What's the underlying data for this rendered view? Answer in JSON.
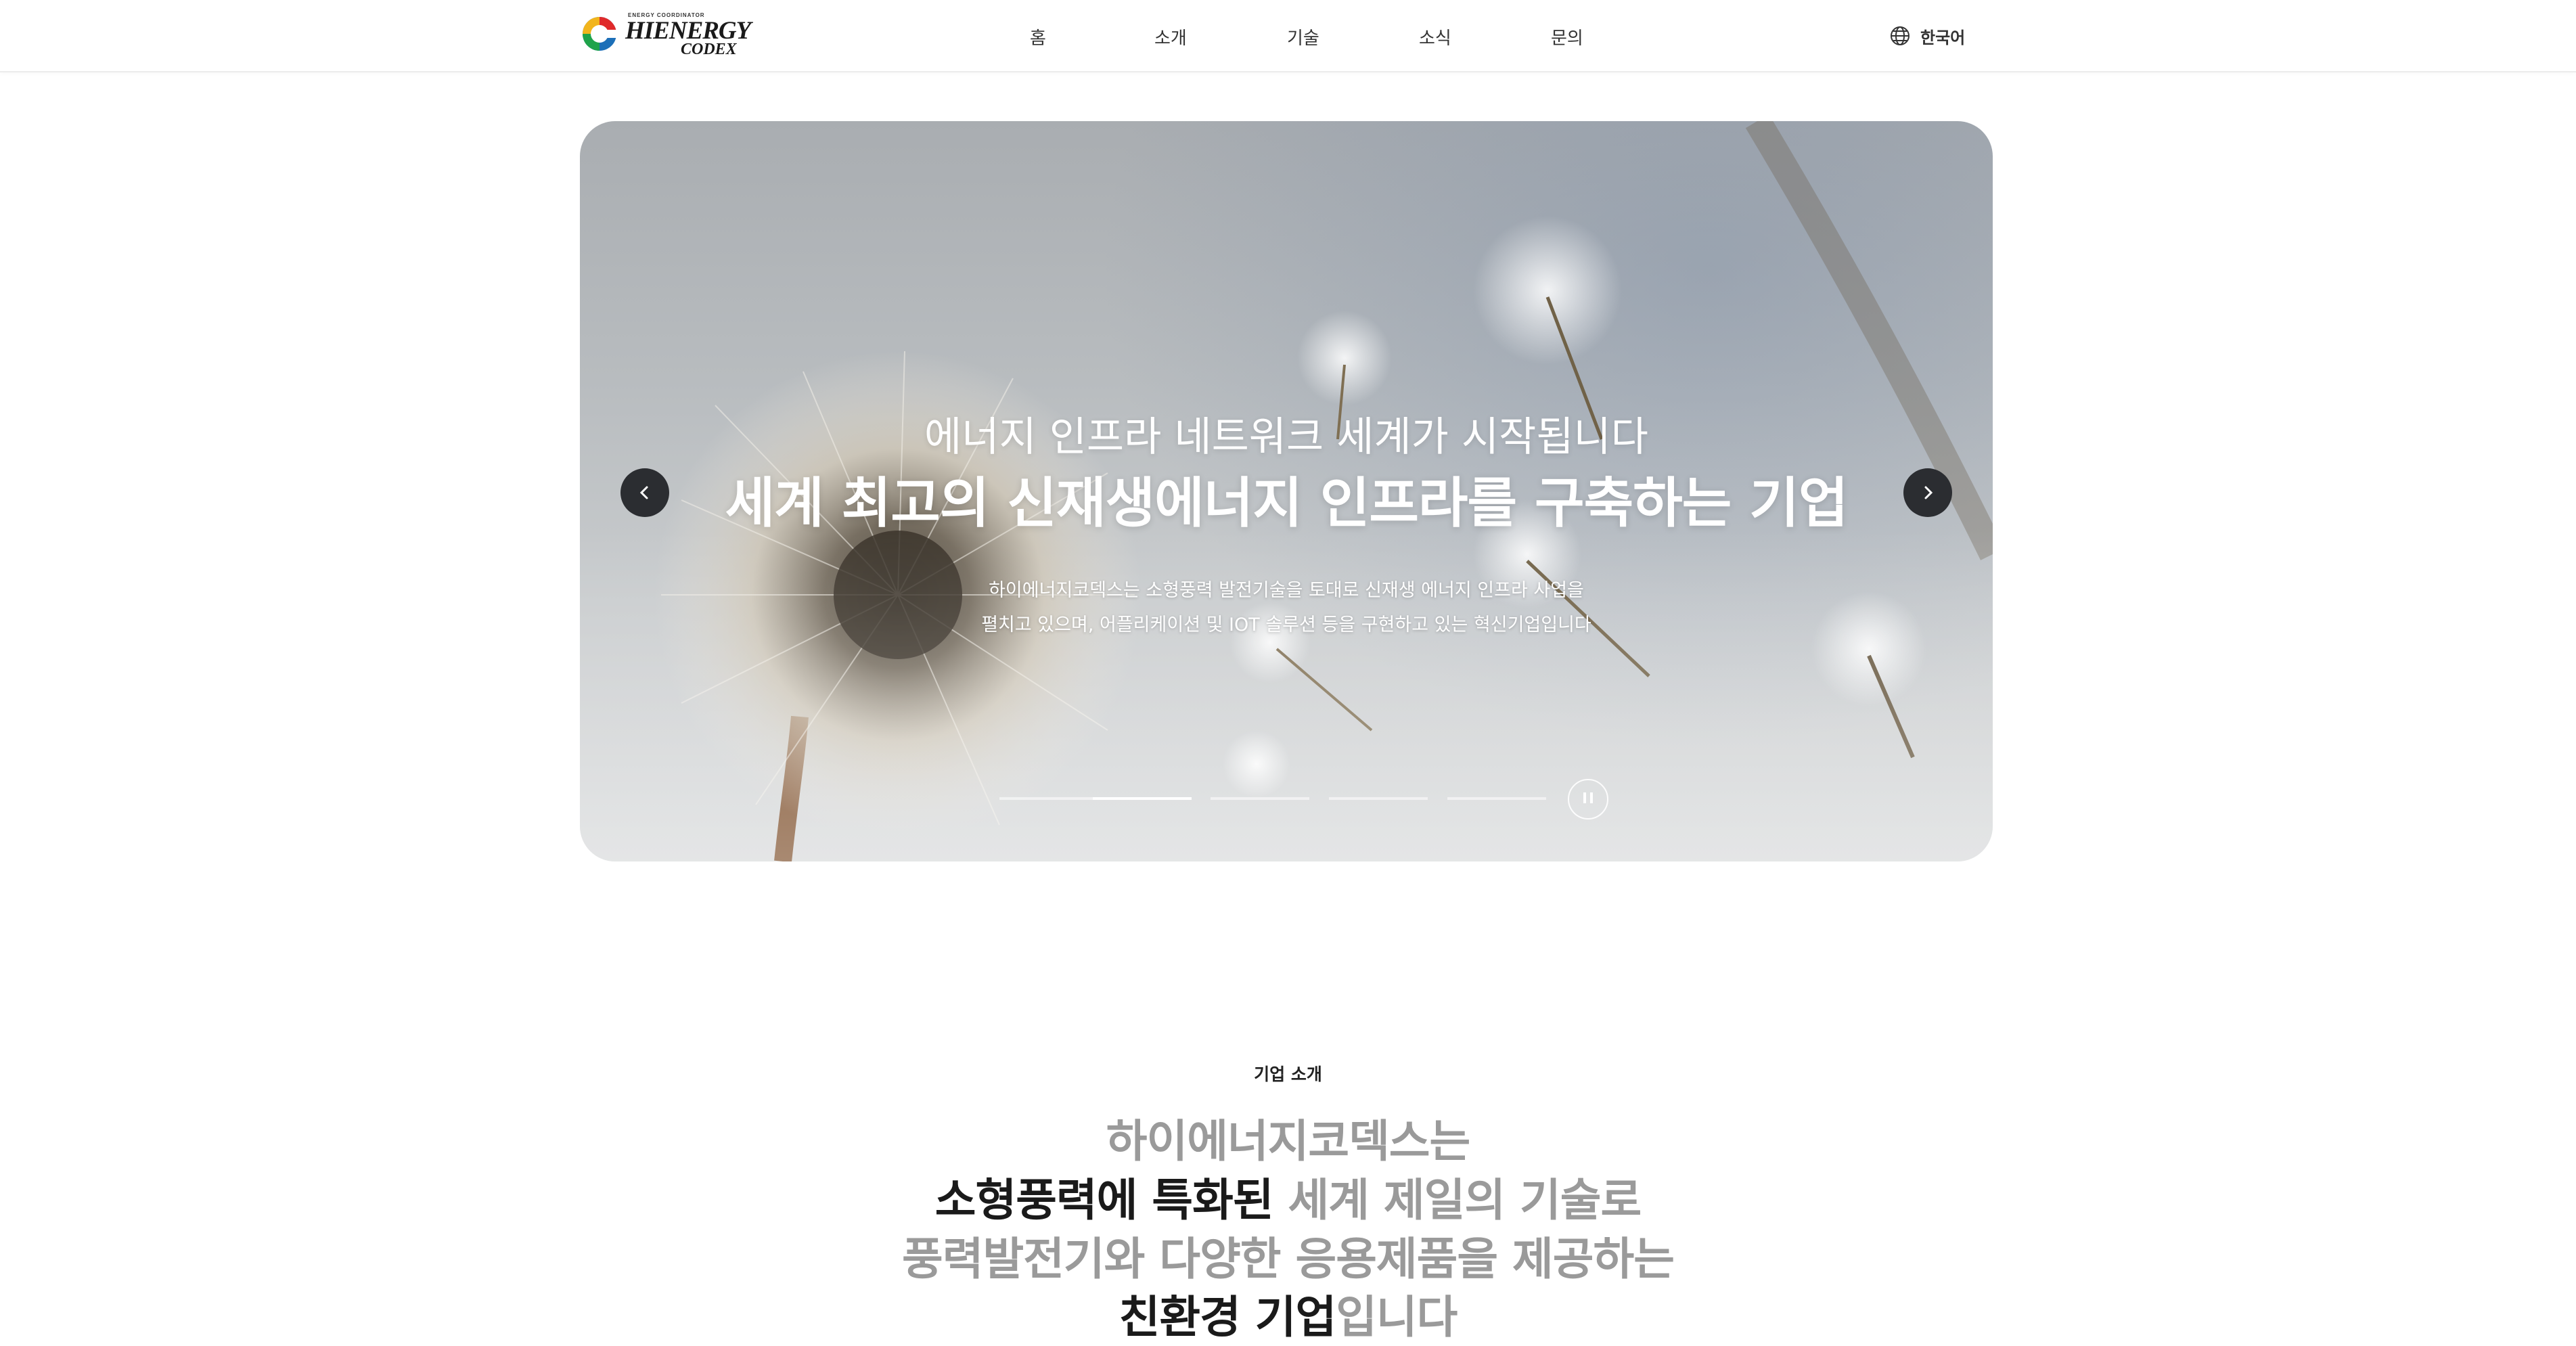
{
  "header": {
    "logo": {
      "small_text": "ENERGY COORDINATOR",
      "main_text": "HIENERGY",
      "sub_text": "CODEX",
      "icon": "hienergy-logo-icon",
      "colors": [
        "#e02a2a",
        "#f2b51c",
        "#1fa34a",
        "#1c6fb8"
      ]
    },
    "nav": [
      {
        "label": "홈"
      },
      {
        "label": "소개"
      },
      {
        "label": "기술"
      },
      {
        "label": "소식"
      },
      {
        "label": "문의"
      }
    ],
    "language": {
      "icon": "globe-icon",
      "label": "한국어"
    }
  },
  "hero": {
    "subtitle": "에너지 인프라 네트워크 세계가 시작됩니다",
    "title": "세계 최고의 신재생에너지 인프라를 구축하는 기업",
    "description": [
      "하이에너지코덱스는 소형풍력 발전기술을 토대로 신재생 에너지 인프라 사업을",
      "펼치고 있으며, 어플리케이션 및 IOT 솔루션 등을 구현하고 있는 혁신기업입니다"
    ],
    "prev_icon": "chevron-left-icon",
    "next_icon": "chevron-right-icon",
    "pause_icon": "pause-icon",
    "slide_count": 5,
    "active_slide": 2
  },
  "intro": {
    "label": "기업 소개",
    "lines": [
      [
        {
          "text": "하이에너지코덱스는",
          "dark": false
        }
      ],
      [
        {
          "text": "소형풍력에 특화된",
          "dark": true
        },
        {
          "text": " 세계 제일의 기술로",
          "dark": false
        }
      ],
      [
        {
          "text": "풍력발전기와 다양한 응용제품을 제공하는",
          "dark": false
        }
      ],
      [
        {
          "text": "친환경 기업",
          "dark": true
        },
        {
          "text": "입니다",
          "dark": false
        }
      ]
    ]
  }
}
